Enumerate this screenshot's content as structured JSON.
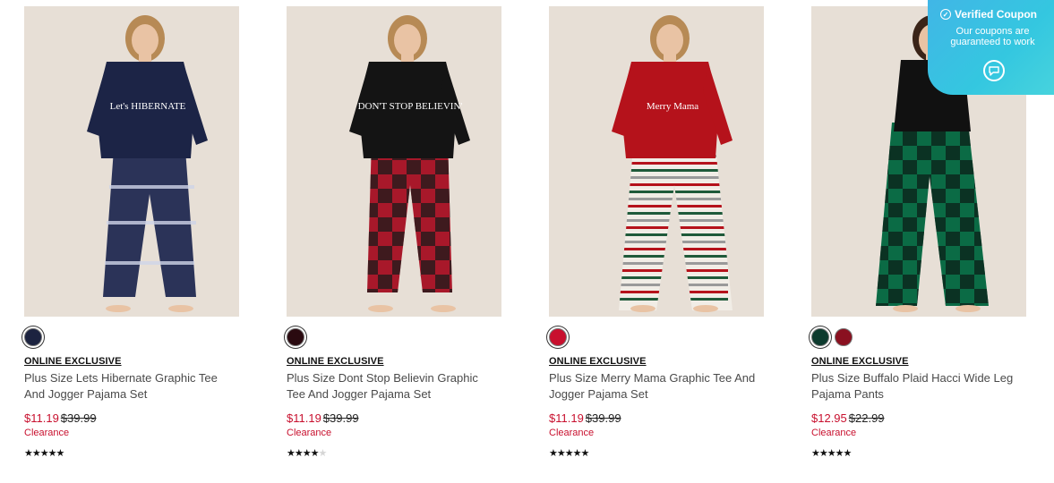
{
  "products": [
    {
      "badge": "ONLINE EXCLUSIVE",
      "name": "Plus Size Lets Hibernate Graphic Tee And Jogger Pajama Set",
      "sale_price": "$11.19",
      "original_price": "$39.99",
      "clearance": "Clearance",
      "rating": 4.5,
      "swatches": [
        {
          "color": "#1c2340",
          "selected": true
        }
      ],
      "top_color": "#1c2446",
      "bottom_color": "#2b3358",
      "graphic_text": "Let's HIBERNATE"
    },
    {
      "badge": "ONLINE EXCLUSIVE",
      "name": "Plus Size Dont Stop Believin Graphic Tee And Jogger Pajama Set",
      "sale_price": "$11.19",
      "original_price": "$39.99",
      "clearance": "Clearance",
      "rating": 3.5,
      "swatches": [
        {
          "color": "#2a0a10",
          "selected": true
        }
      ],
      "top_color": "#141414",
      "bottom_color": "#a8182a",
      "graphic_text": "DON'T STOP BELIEVIN'"
    },
    {
      "badge": "ONLINE EXCLUSIVE",
      "name": "Plus Size Merry Mama Graphic Tee And Jogger Pajama Set",
      "sale_price": "$11.19",
      "original_price": "$39.99",
      "clearance": "Clearance",
      "rating": 5,
      "swatches": [
        {
          "color": "#c8102e",
          "selected": true
        }
      ],
      "top_color": "#b5121b",
      "bottom_color": "#f1ede6",
      "graphic_text": "Merry Mama"
    },
    {
      "badge": "ONLINE EXCLUSIVE",
      "name": "Plus Size Buffalo Plaid Hacci Wide Leg Pajama Pants",
      "sale_price": "$12.95",
      "original_price": "$22.99",
      "clearance": "Clearance",
      "rating": 4.5,
      "swatches": [
        {
          "color": "#0d3b2e",
          "selected": true
        },
        {
          "color": "#8a1020",
          "selected": false
        }
      ],
      "top_color": "#111111",
      "bottom_color": "#0b6b45",
      "graphic_text": ""
    }
  ],
  "coupon": {
    "title": "Verified Coupon",
    "text": "Our coupons are guaranteed to work",
    "icon": "chat-bubble-icon"
  },
  "colors": {
    "sale": "#c8102e",
    "coupon_bg": "#41b6e6"
  }
}
